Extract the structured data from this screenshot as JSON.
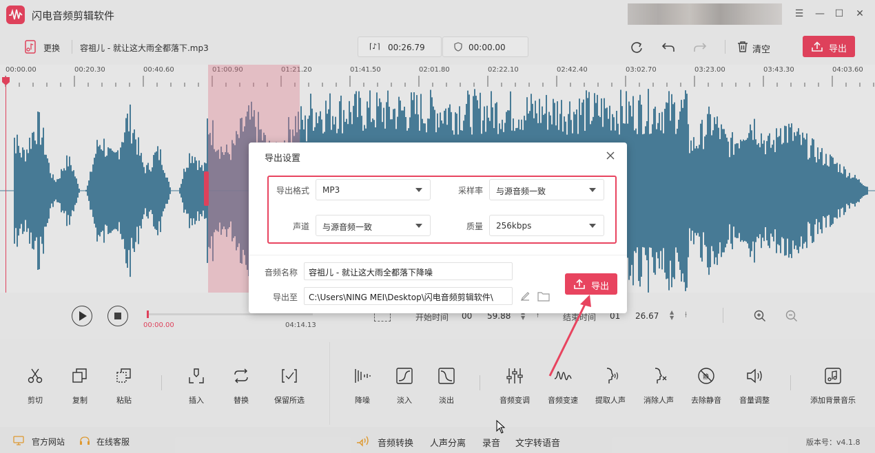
{
  "app": {
    "title": "闪电音频剪辑软件"
  },
  "toolbar": {
    "replace_label": "更换",
    "filename": "容祖儿 - 就让这大雨全都落下.mp3",
    "duration": "00:26.79",
    "position": "00:00.00",
    "clear_label": "清空",
    "export_label": "导出"
  },
  "ruler": {
    "labels": [
      "00:00.00",
      "00:20.30",
      "00:40.60",
      "01:00.90",
      "01:21.20",
      "01:41.50",
      "02:01.80",
      "02:22.10",
      "02:42.40",
      "03:02.70",
      "03:23.00",
      "03:43.30",
      "04:03.60"
    ]
  },
  "transport": {
    "current_time": "00:00.00",
    "total_time": "04:14.13",
    "start_label": "开始时间",
    "start_min": "00",
    "start_sec": "59.88",
    "end_label": "结束时间",
    "end_min": "01",
    "end_sec": "26.67"
  },
  "tools": {
    "cut": "剪切",
    "copy": "复制",
    "paste": "粘贴",
    "insert": "插入",
    "replace": "替换",
    "keep": "保留所选",
    "denoise": "降噪",
    "fade_in": "淡入",
    "fade_out": "淡出",
    "tone": "音频变调",
    "speed": "音频变速",
    "extract_voice": "提取人声",
    "remove_voice": "消除人声",
    "remove_silence": "去除静音",
    "volume": "音量调整",
    "add_bgm": "添加背景音乐"
  },
  "footer": {
    "website": "官方网站",
    "service": "在线客服",
    "convert": "音频转换",
    "separate": "人声分离",
    "record": "录音",
    "tts": "文字转语音",
    "version": "版本号：v4.1.8"
  },
  "dialog": {
    "title": "导出设置",
    "format_label": "导出格式",
    "format_value": "MP3",
    "samplerate_label": "采样率",
    "samplerate_value": "与源音频一致",
    "channel_label": "声道",
    "channel_value": "与源音频一致",
    "quality_label": "质量",
    "quality_value": "256kbps",
    "name_label": "音频名称",
    "name_value": "容祖儿 - 就让这大雨全都落下降噪",
    "path_label": "导出至",
    "path_value": "C:\\Users\\NING MEI\\Desktop\\闪电音频剪辑软件\\",
    "export_label": "导出"
  },
  "colors": {
    "accent": "#e8445f",
    "wave": "#4a7f9c",
    "wave_selected": "#5d88a0"
  }
}
